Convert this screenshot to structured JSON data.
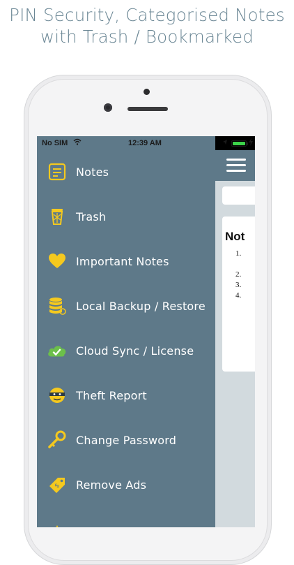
{
  "headline": {
    "line1": "PIN Security, Categorised Notes",
    "line2": "with Trash / Bookmarked"
  },
  "status_bar": {
    "carrier": "No SIM",
    "time": "12:39 AM"
  },
  "drawer": {
    "background_color": "#5e7989",
    "icon_color": "#f5c91e",
    "items": [
      {
        "label": "Notes",
        "icon": "notes-icon"
      },
      {
        "label": "Trash",
        "icon": "trash-icon"
      },
      {
        "label": "Important Notes",
        "icon": "heart-icon"
      },
      {
        "label": "Local Backup / Restore",
        "icon": "database-icon"
      },
      {
        "label": "Cloud Sync / License",
        "icon": "cloud-check-icon"
      },
      {
        "label": "Theft Report",
        "icon": "thief-icon"
      },
      {
        "label": "Change Password",
        "icon": "key-icon"
      },
      {
        "label": "Remove Ads",
        "icon": "price-tag-icon"
      }
    ]
  },
  "content": {
    "title_partial": "Not",
    "list_numbers": [
      "1.",
      "2.",
      "3.",
      "4."
    ]
  }
}
